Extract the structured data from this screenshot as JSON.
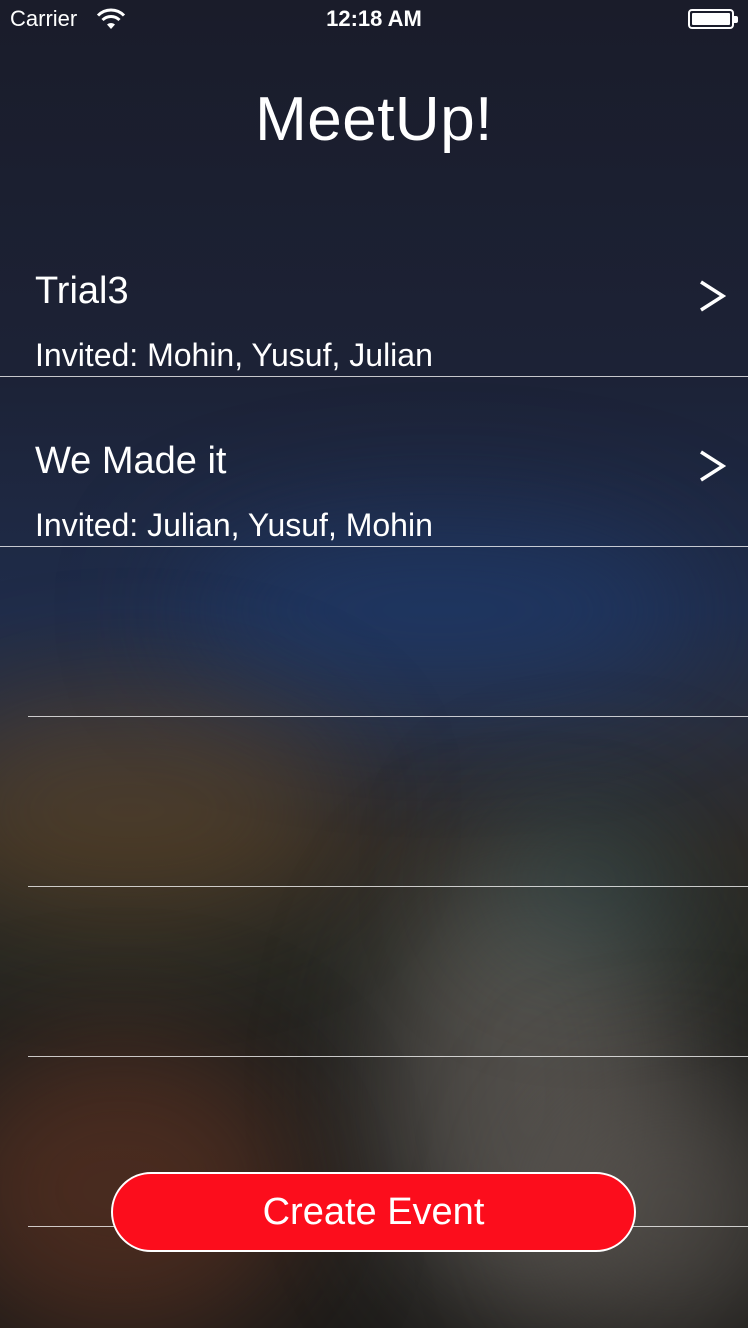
{
  "status_bar": {
    "carrier": "Carrier",
    "time": "12:18 AM",
    "wifi_icon": "wifi-icon",
    "battery_icon": "battery-icon"
  },
  "header": {
    "title": "MeetUp!"
  },
  "events": [
    {
      "name": "Trial3",
      "invited": "Invited: Mohin, Yusuf, Julian",
      "chevron": ">"
    },
    {
      "name": "We Made it",
      "invited": "Invited: Julian, Yusuf, Mohin",
      "chevron": ">"
    }
  ],
  "actions": {
    "create_event_label": "Create Event"
  },
  "colors": {
    "button_red": "#fc0d1c",
    "text": "#ffffff"
  }
}
